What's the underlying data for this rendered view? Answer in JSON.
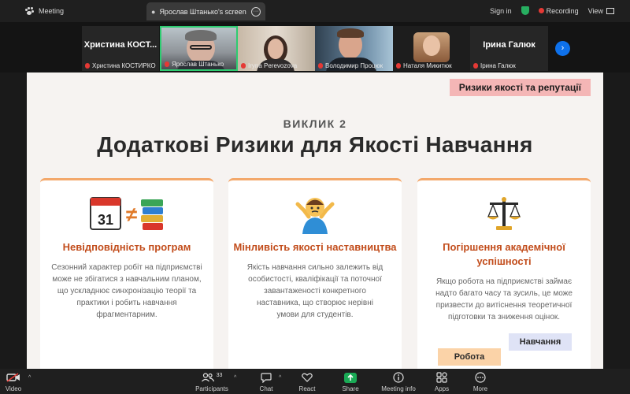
{
  "topbar": {
    "app_title": "Meeting",
    "share_tab": "Ярослав Штанько's screen",
    "signin": "Sign in",
    "recording": "Recording",
    "view": "View"
  },
  "participants_strip": [
    {
      "big_name": "Христина КОСТ...",
      "label": "Христина КОСТИРКО",
      "video": false
    },
    {
      "big_name": "",
      "label": "Ярослав Штанько",
      "video": true,
      "active": true
    },
    {
      "big_name": "",
      "label": "Iryna Perevozova",
      "video": true
    },
    {
      "big_name": "",
      "label": "Володимир Процюк",
      "video": true
    },
    {
      "big_name": "",
      "label": "Наталя Микитюк",
      "video": true
    },
    {
      "big_name": "Ірина Галюк",
      "label": "Ірина Галюк",
      "video": false
    }
  ],
  "slide": {
    "badge": "Ризики якості та репутації",
    "kicker": "ВИКЛИК 2",
    "title": "Додаткові Ризики для Якості Навчання",
    "cards": [
      {
        "icon": "calendar-not-equal-books-icon",
        "calendar_day": "31",
        "heading": "Невідповідність програм",
        "text": "Сезонний характер робіт на підприємстві може не збігатися з навчальним планом, що ускладнює синхронізацію теорії та практики і робить навчання фрагментарним."
      },
      {
        "icon": "person-shrugging-icon",
        "heading": "Мінливість якості наставництва",
        "text": "Якість навчання сильно залежить від особистості, кваліфікації та поточної завантаженості конкретного наставника, що створює нерівні умови для студентів."
      },
      {
        "icon": "balance-scale-icon",
        "heading": "Погіршення академічної успішності",
        "text": "Якщо робота на підприємстві займає надто багато часу та зусиль, це може призвести до витіснення теоретичної підготовки та зниження оцінок.",
        "tag_work": "Робота",
        "tag_study": "Навчання"
      }
    ]
  },
  "toolbar": {
    "video": "Video",
    "participants": "Participants",
    "participants_count": "33",
    "chat": "Chat",
    "react": "React",
    "share": "Share",
    "meeting_info": "Meeting info",
    "apps": "Apps",
    "more": "More"
  },
  "colors": {
    "accent_blue": "#0e71eb",
    "share_green": "#1aaa55",
    "heading_orange": "#c24d1c",
    "badge_pink": "#f4b6b6",
    "card_border": "#f3a86b"
  }
}
